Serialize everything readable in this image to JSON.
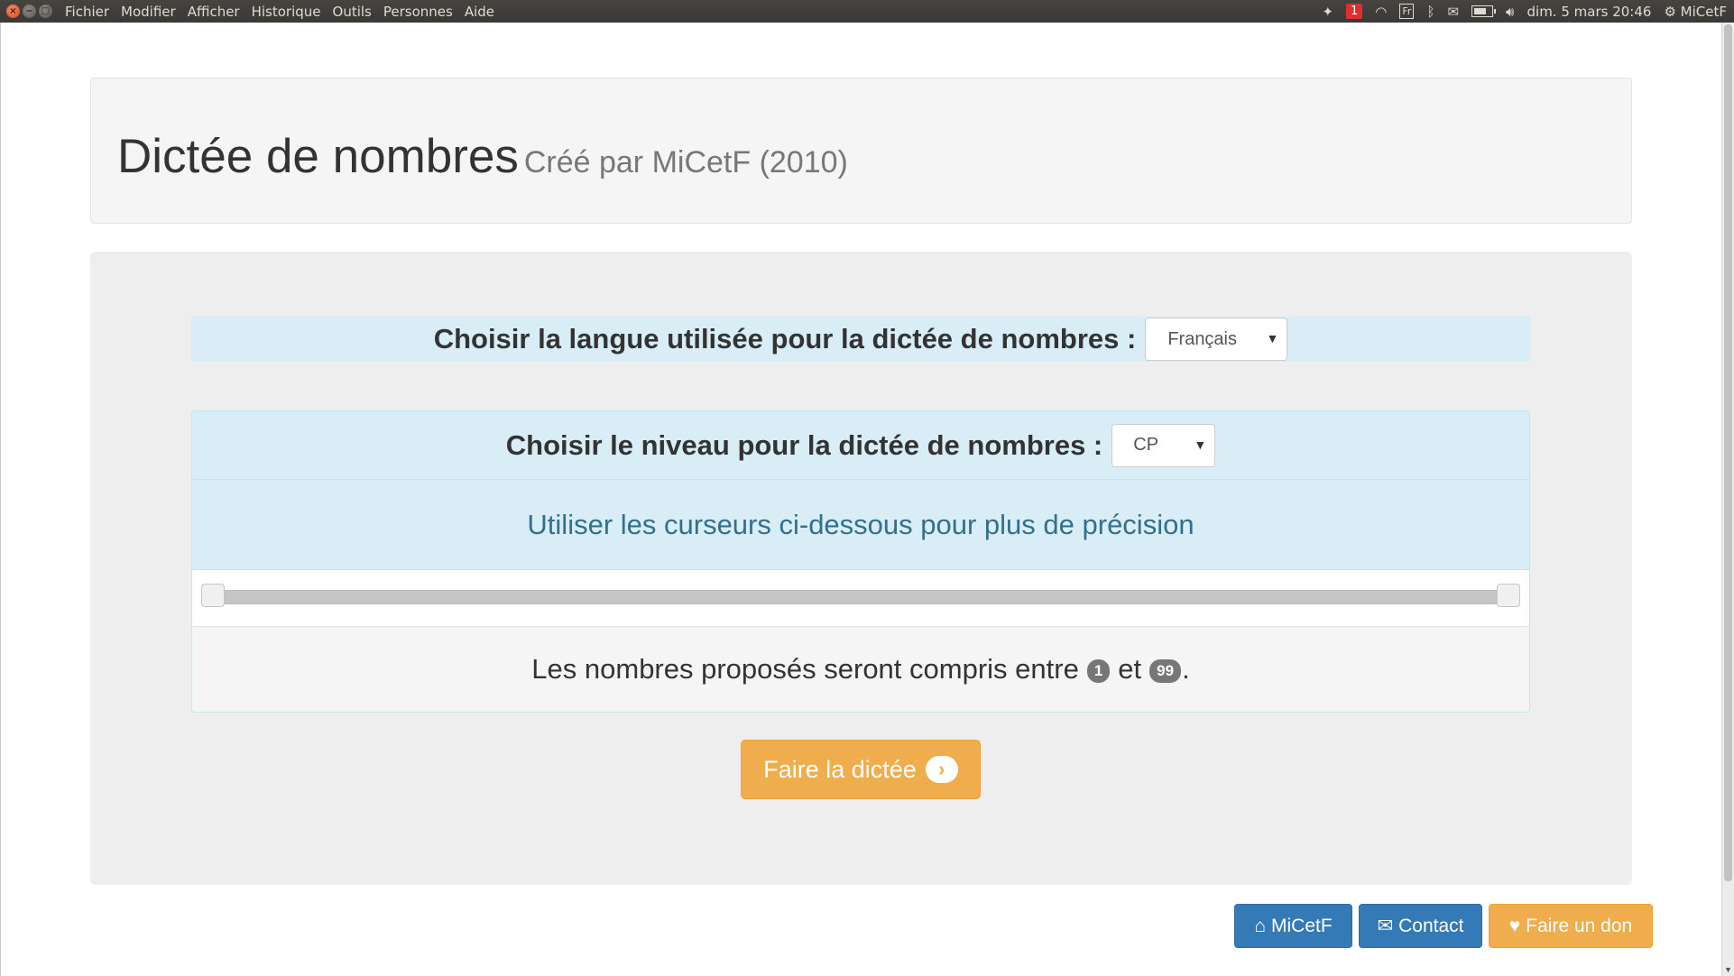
{
  "menubar": {
    "items": [
      "Fichier",
      "Modifier",
      "Afficher",
      "Historique",
      "Outils",
      "Personnes",
      "Aide"
    ],
    "notification_count": "1",
    "keyboard_layout": "Fr",
    "clock": "dim. 5 mars 20:46",
    "user": "MiCetF"
  },
  "header": {
    "title": "Dictée de nombres",
    "subtitle": "Créé par MiCetF (2010)"
  },
  "language": {
    "label": "Choisir la langue utilisée pour la dictée de nombres :",
    "selected": "Français"
  },
  "level": {
    "label": "Choisir le niveau pour la dictée de nombres :",
    "selected": "CP",
    "hint": "Utiliser les curseurs ci-dessous pour plus de précision"
  },
  "range": {
    "text_before": "Les nombres proposés seront compris entre",
    "min": "1",
    "text_between": "et",
    "max": "99",
    "text_after": ".",
    "slider_low_fraction": 0.0,
    "slider_high_fraction": 1.0
  },
  "actions": {
    "start_label": "Faire la dictée"
  },
  "footer": {
    "home_label": "MiCetF",
    "contact_label": "Contact",
    "donate_label": "Faire un don"
  },
  "colors": {
    "info_bg": "#d9edf7",
    "info_text": "#31708f",
    "warning": "#f0ad4e",
    "primary": "#337ab7",
    "badge": "#777777"
  }
}
